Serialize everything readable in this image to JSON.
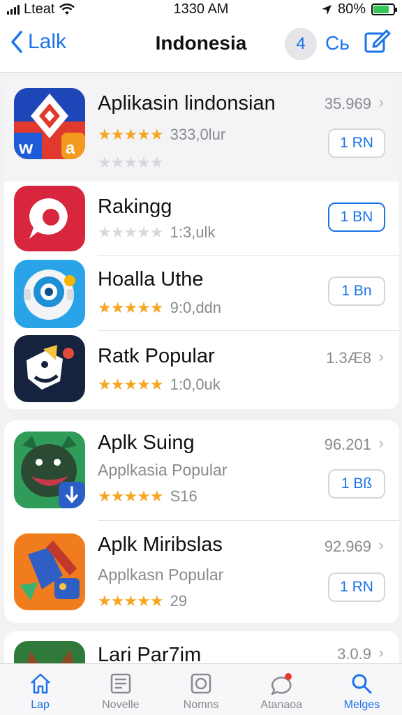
{
  "status": {
    "carrier": "Lteat",
    "time": "1330 AM",
    "battery": "80%",
    "battery_level": 0.8,
    "battery_color": "#34c759"
  },
  "nav": {
    "back_label": "Lalk",
    "title": "Indonesia",
    "circle_label": "4",
    "link_label": "Cь"
  },
  "apps": [
    {
      "name": "Aplikasin lindonsian",
      "rating_text": "333,0lur",
      "size": "35.969",
      "get": "1 RN",
      "stars": 5
    },
    {
      "name": "Rakingg",
      "rating_text": "1:3,ulk",
      "get": "1 BN",
      "stars": 0
    },
    {
      "name": "Hoalla Uthe",
      "rating_text": "9:0,ddn",
      "get": "1 Bn",
      "stars": 5
    },
    {
      "name": "Ratk Popular",
      "rating_text": "1:0,0uk",
      "size": "1.3Æ8",
      "stars": 5
    },
    {
      "name": "Aplk Suing",
      "subtitle": "Applkasia Popular",
      "rating_text": "S16",
      "size": "96.201",
      "get": "1 Bß",
      "stars": 5
    },
    {
      "name": "Aplk Miribslas",
      "subtitle": "Applkasn Popular",
      "rating_text": "29",
      "size": "92.969",
      "get": "1 RN",
      "stars": 5
    },
    {
      "name": "Lari Par7im",
      "size": "3.0.9"
    }
  ],
  "tabs": [
    {
      "label": "Lap",
      "icon": "home-icon"
    },
    {
      "label": "Novelle",
      "icon": "news-icon"
    },
    {
      "label": "Nomns",
      "icon": "games-icon"
    },
    {
      "label": "Atanaoa",
      "icon": "updates-icon"
    },
    {
      "label": "Melges",
      "icon": "search-icon"
    }
  ],
  "colors": {
    "accent": "#1a73e8",
    "star": "#f5a623",
    "background": "#f2f2f4"
  }
}
